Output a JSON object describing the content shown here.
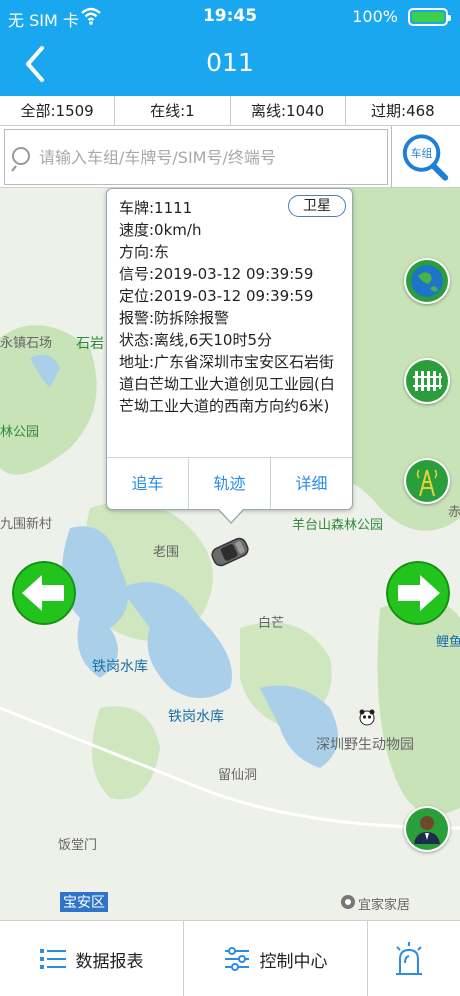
{
  "status_bar": {
    "carrier": "无 SIM 卡",
    "time": "19:45",
    "battery": "100%"
  },
  "nav": {
    "title": "011"
  },
  "counts": [
    {
      "label": "全部:1509"
    },
    {
      "label": "在线:1"
    },
    {
      "label": "离线:1040"
    },
    {
      "label": "过期:468"
    }
  ],
  "search": {
    "placeholder": "请输入车组/车牌号/SIM号/终端号",
    "button_icon_text": "车组"
  },
  "map_labels": {
    "yongjing": "永镇石场",
    "shiyan": "石岩",
    "lin_park": "林公园",
    "jiuwei": "九围新村",
    "laowei": "老围",
    "yangtai": "羊台山森林公园",
    "baimang": "白芒",
    "tiegang1": "铁岗水库",
    "tiegang2": "铁岗水库",
    "zoo": "深圳野生动物园",
    "liuxian": "留仙洞",
    "yantang": "饭堂门",
    "baoan": "宝安区",
    "ikea": "宜家家居",
    "chi": "赤",
    "li": "鲤鱼"
  },
  "popup": {
    "sat_button": "卫星",
    "plate": "车牌:1111",
    "speed": "速度:0km/h",
    "direction": "方向:东",
    "signal": "信号:2019-03-12 09:39:59",
    "position": "定位:2019-03-12 09:39:59",
    "alarm": "报警:防拆除报警",
    "state": "状态:离线,6天10时5分",
    "address": "地址:广东省深圳市宝安区石岩街道白芒坳工业大道创见工业园(白芒坳工业大道的西南方向约6米)",
    "actions": {
      "track": "追车",
      "trail": "轨迹",
      "detail": "详细"
    }
  },
  "tabs": [
    {
      "label": "数据报表",
      "icon": "list-icon"
    },
    {
      "label": "控制中心",
      "icon": "sliders-icon"
    },
    {
      "label": "",
      "icon": "alarm-light-icon"
    }
  ],
  "colors": {
    "nav_bg": "#19a8f0",
    "link": "#2a8ee6",
    "arrow_green": "#22c31c",
    "water": "#a9cfe9",
    "green_area": "#c9e3b9"
  }
}
